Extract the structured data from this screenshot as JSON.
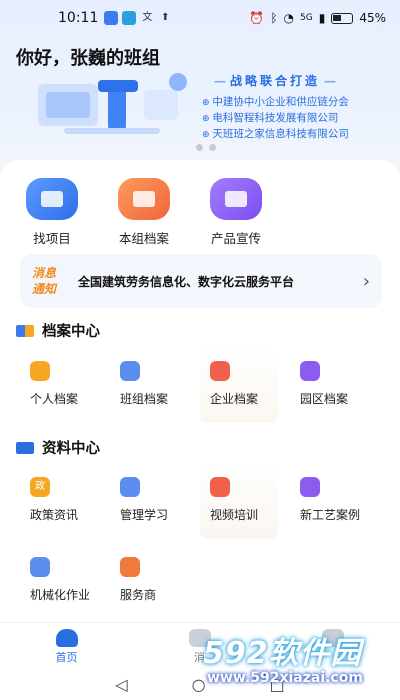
{
  "status_bar": {
    "time": "10:11",
    "battery": "45%",
    "signal": "5G"
  },
  "header": {
    "greeting": "你好，张巍的班组"
  },
  "banner": {
    "title": "战略联合打造",
    "partners": [
      "中建协中小企业和供应链分会",
      "电科智程科技发展有限公司",
      "天班班之家信息科技有限公司"
    ]
  },
  "quick_actions": [
    {
      "label": "找项目",
      "icon": "folder-icon",
      "color": "#3a7cf0"
    },
    {
      "label": "本组档案",
      "icon": "archive-icon",
      "color": "#f07a3c"
    },
    {
      "label": "产品宣传",
      "icon": "building-icon",
      "color": "#8c5cf0"
    }
  ],
  "notice": {
    "badge_line1": "消息",
    "badge_line2": "通知",
    "text": "全国建筑劳务信息化、数字化云服务平台",
    "arrow": "›"
  },
  "archive_center": {
    "title": "档案中心",
    "items": [
      {
        "label": "个人档案",
        "icon": "user-file-icon",
        "color": "#f5a623"
      },
      {
        "label": "班组档案",
        "icon": "team-file-icon",
        "color": "#5b8def"
      },
      {
        "label": "企业档案",
        "icon": "company-file-icon",
        "color": "#f0604a"
      },
      {
        "label": "园区档案",
        "icon": "park-file-icon",
        "color": "#8c5cf0"
      }
    ]
  },
  "resource_center": {
    "title": "资料中心",
    "items": [
      {
        "label": "政策资讯",
        "icon": "policy-icon",
        "glyph": "政",
        "color": "#f5a623"
      },
      {
        "label": "管理学习",
        "icon": "learning-icon",
        "glyph": "",
        "color": "#5b8def"
      },
      {
        "label": "视频培训",
        "icon": "video-icon",
        "glyph": "",
        "color": "#f0604a"
      },
      {
        "label": "新工艺案例",
        "icon": "process-icon",
        "glyph": "",
        "color": "#8c5cf0"
      },
      {
        "label": "机械化作业",
        "icon": "machinery-icon",
        "glyph": "",
        "color": "#5b8def"
      },
      {
        "label": "服务商",
        "icon": "service-icon",
        "glyph": "",
        "color": "#f07a3c"
      }
    ]
  },
  "bottom_nav": [
    {
      "label": "首页",
      "active": true
    },
    {
      "label": "消",
      "active": false
    },
    {
      "label": "",
      "active": false
    }
  ],
  "watermark": {
    "logo": "592软件园",
    "url": "www.592xiazai.com"
  },
  "colors": {
    "accent": "#2a6fe0",
    "notice_badge": "#f08c1a"
  }
}
